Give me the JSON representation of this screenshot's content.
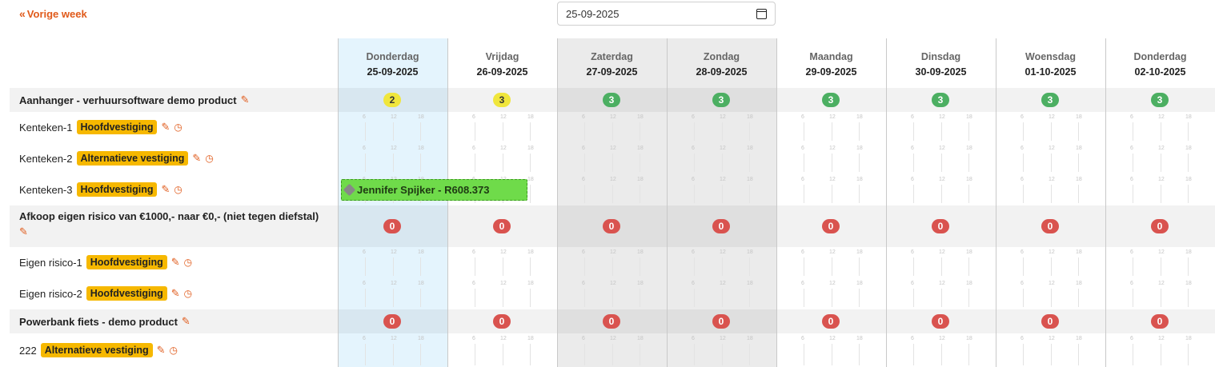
{
  "nav": {
    "prev_week": "Vorige week",
    "date_value": "25-09-2025"
  },
  "days": [
    {
      "day": "Donderdag",
      "date": "25-09-2025"
    },
    {
      "day": "Vrijdag",
      "date": "26-09-2025"
    },
    {
      "day": "Zaterdag",
      "date": "27-09-2025"
    },
    {
      "day": "Zondag",
      "date": "28-09-2025"
    },
    {
      "day": "Maandag",
      "date": "29-09-2025"
    },
    {
      "day": "Dinsdag",
      "date": "30-09-2025"
    },
    {
      "day": "Woensdag",
      "date": "01-10-2025"
    },
    {
      "day": "Donderdag",
      "date": "02-10-2025"
    }
  ],
  "groups": [
    {
      "name": "Aanhanger - verhuursoftware demo product",
      "counts": [
        "2",
        "3",
        "3",
        "3",
        "3",
        "3",
        "3",
        "3"
      ],
      "count_colors": [
        "yellow",
        "yellow",
        "green",
        "green",
        "green",
        "green",
        "green",
        "green"
      ],
      "items": [
        {
          "name": "Kenteken-1",
          "location": "Hoofdvestiging"
        },
        {
          "name": "Kenteken-2",
          "location": "Alternatieve vestiging"
        },
        {
          "name": "Kenteken-3",
          "location": "Hoofdvestiging"
        }
      ]
    },
    {
      "name": "Afkoop eigen risico van €1000,- naar €0,- (niet tegen diefstal)",
      "counts": [
        "0",
        "0",
        "0",
        "0",
        "0",
        "0",
        "0",
        "0"
      ],
      "count_colors": [
        "red",
        "red",
        "red",
        "red",
        "red",
        "red",
        "red",
        "red"
      ],
      "items": [
        {
          "name": "Eigen risico-1",
          "location": "Hoofdvestiging"
        },
        {
          "name": "Eigen risico-2",
          "location": "Hoofdvestiging"
        }
      ]
    },
    {
      "name": "Powerbank fiets - demo product",
      "counts": [
        "0",
        "0",
        "0",
        "0",
        "0",
        "0",
        "0",
        "0"
      ],
      "count_colors": [
        "red",
        "red",
        "red",
        "red",
        "red",
        "red",
        "red",
        "red"
      ],
      "items": [
        {
          "name": "222",
          "location": "Alternatieve vestiging"
        }
      ]
    }
  ],
  "booking": {
    "label": "Jennifer Spijker - R608.373"
  },
  "tick_labels": [
    "6",
    "12",
    "18"
  ],
  "icons": {
    "prev": "double-chevron-left-icon",
    "edit": "pencil-icon",
    "history": "clock-icon",
    "calendar": "calendar-icon",
    "tag": "tag-icon"
  },
  "colors": {
    "accent": "#e05a1a",
    "today": "#e4f4fd",
    "weekend": "#ebebeb",
    "badge": "#f6b800",
    "booking": "#6fdb4a"
  }
}
